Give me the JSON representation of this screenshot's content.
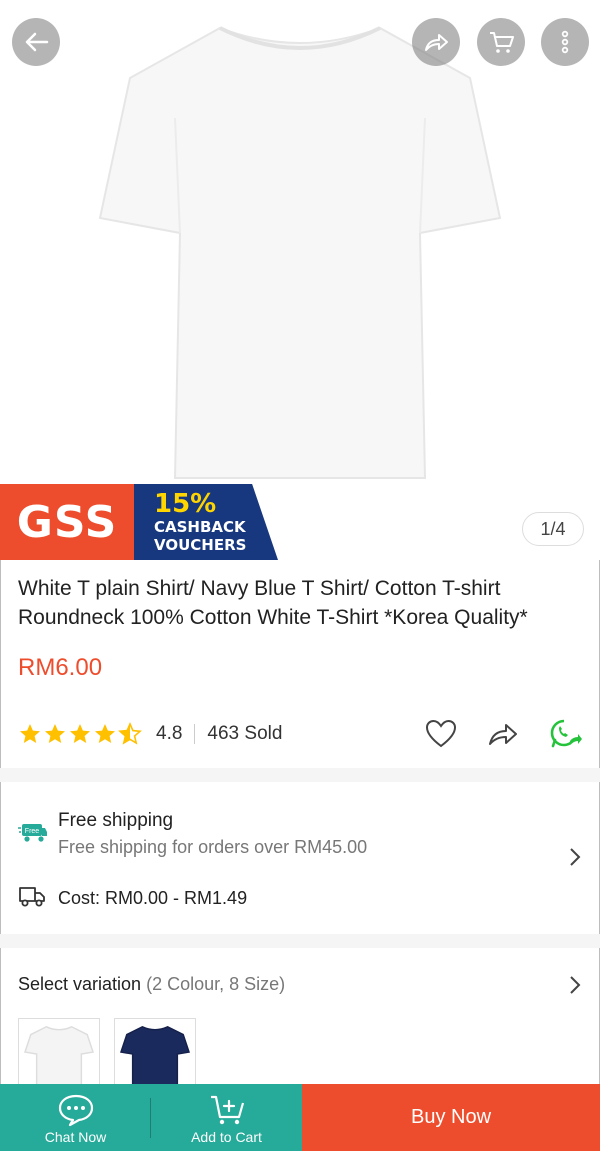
{
  "header": {
    "back_icon": "arrow-left-icon",
    "share_icon": "share-arrow-icon",
    "cart_icon": "cart-icon",
    "more_icon": "more-vertical-icon"
  },
  "promo": {
    "left_text": "GSS",
    "percent": "15%",
    "line1": "CASHBACK",
    "line2": "VOUCHERS"
  },
  "gallery": {
    "pager": "1/4"
  },
  "product": {
    "title": "White T plain Shirt/ Navy Blue T Shirt/ Cotton T-shirt Roundneck 100% Cotton White T-Shirt *Korea Quality*",
    "price": "RM6.00",
    "rating": "4.8",
    "rating_stars": 4.8,
    "sold": "463 Sold"
  },
  "shipping": {
    "free_icon_text": "Free",
    "title": "Free shipping",
    "subtitle": "Free shipping for orders over RM45.00",
    "cost_label": "Cost:",
    "cost_value": "RM0.00 - RM1.49"
  },
  "variation": {
    "label": "Select variation",
    "count": "(2 Colour, 8 Size)"
  },
  "bottom_bar": {
    "chat": "Chat Now",
    "cart": "Add to Cart",
    "buy": "Buy Now"
  },
  "colors": {
    "brand": "#ee4d2d",
    "teal": "#26aa99",
    "navy": "#17377e",
    "star": "#ffc000",
    "whatsapp": "#25c33b"
  }
}
